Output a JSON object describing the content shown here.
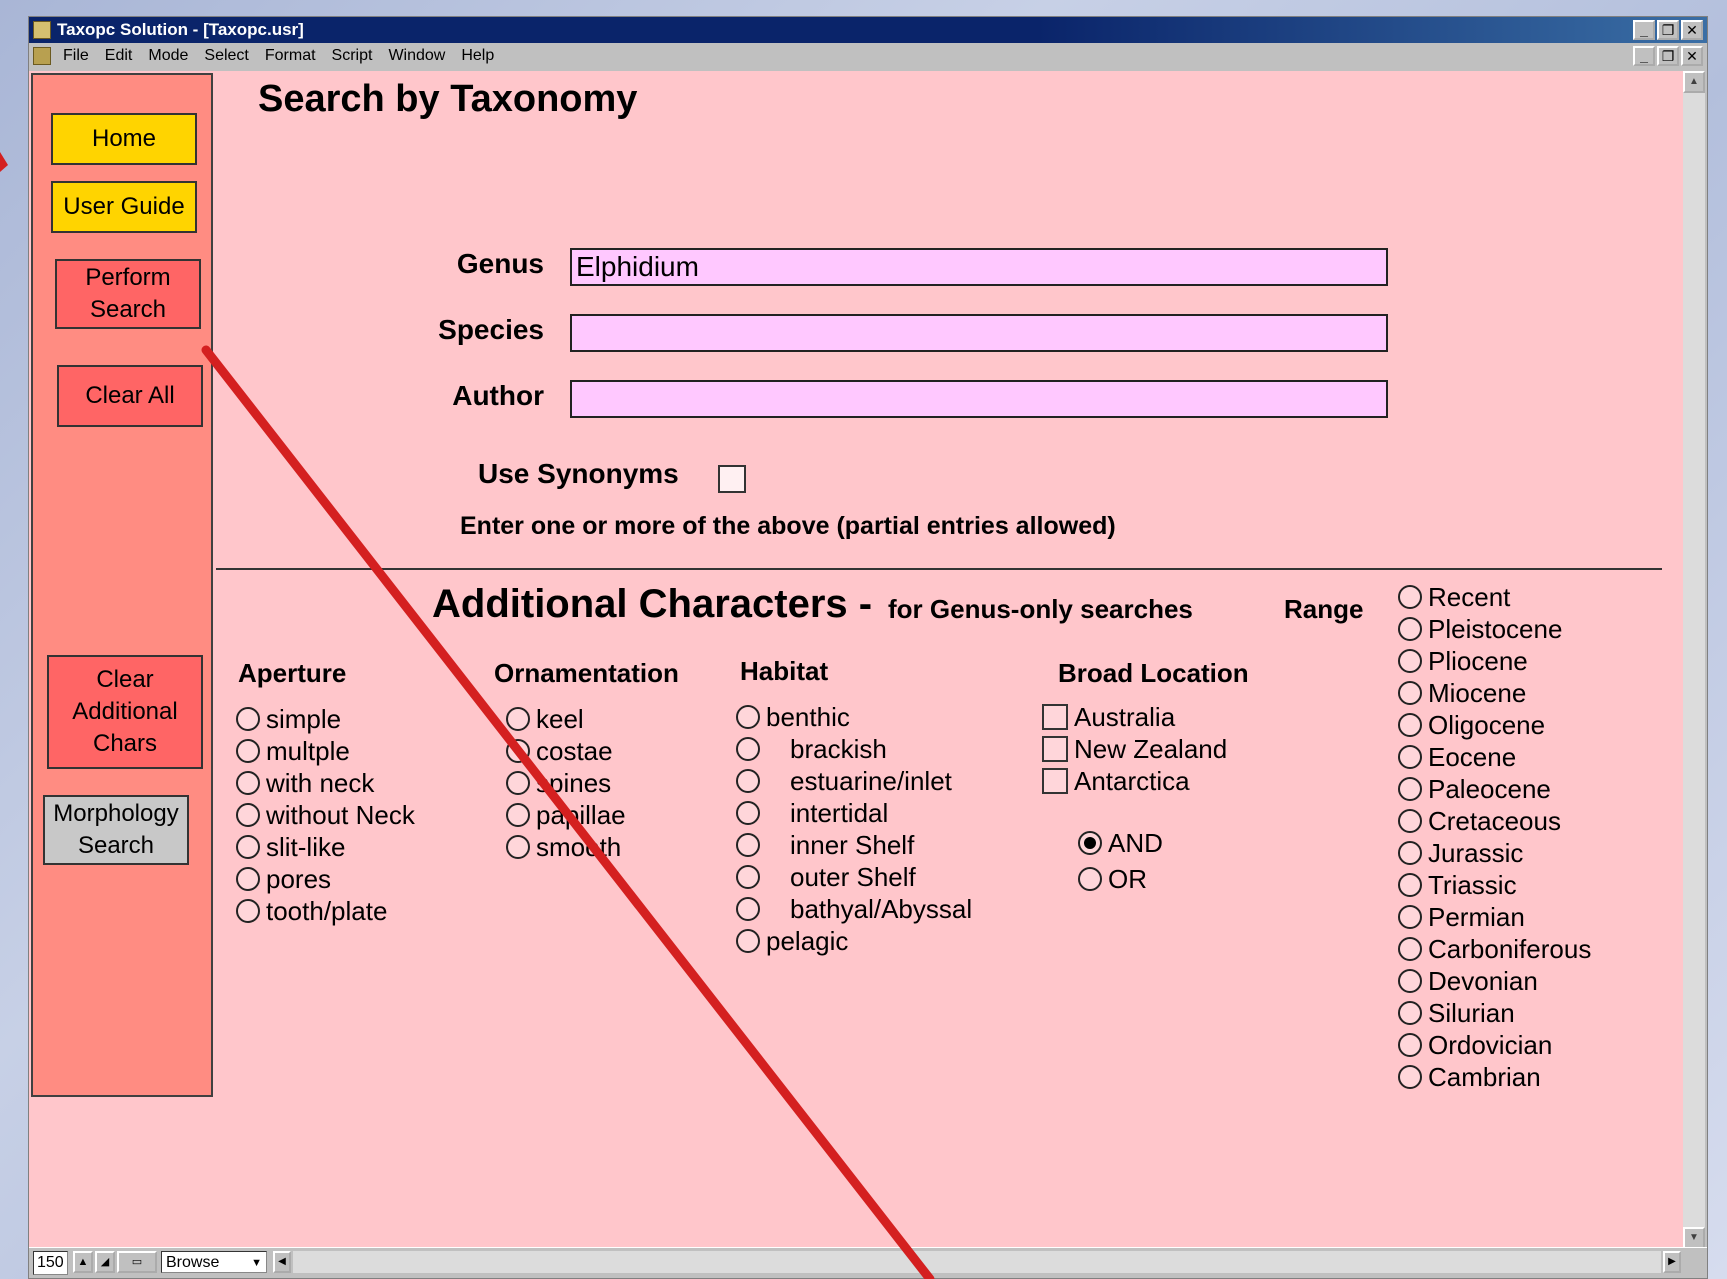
{
  "window": {
    "title": "Taxopc Solution - [Taxopc.usr]"
  },
  "menubar": {
    "items": [
      "File",
      "Edit",
      "Mode",
      "Select",
      "Format",
      "Script",
      "Window",
      "Help"
    ]
  },
  "sidebar": {
    "home": "Home",
    "user_guide": "User Guide",
    "perform_search_1": "Perform",
    "perform_search_2": "Search",
    "clear_all": "Clear All",
    "clear_add_1": "Clear",
    "clear_add_2": "Additional",
    "clear_add_3": "Chars",
    "morph_1": "Morphology",
    "morph_2": "Search"
  },
  "main": {
    "title": "Search by Taxonomy",
    "genus_label": "Genus",
    "genus_value": "Elphidium",
    "species_label": "Species",
    "species_value": "",
    "author_label": "Author",
    "author_value": "",
    "synonyms_label": "Use Synonyms",
    "hint": "Enter one or more of the above (partial entries allowed)"
  },
  "additional": {
    "title": "Additional Characters -",
    "subtitle": "for Genus-only searches",
    "aperture": {
      "label": "Aperture",
      "options": [
        "simple",
        "multple",
        "with neck",
        "without Neck",
        "slit-like",
        "pores",
        "tooth/plate"
      ]
    },
    "ornamentation": {
      "label": "Ornamentation",
      "options": [
        "keel",
        "costae",
        "spines",
        "papillae",
        "smooth"
      ]
    },
    "habitat": {
      "label": "Habitat",
      "options": [
        "benthic",
        "brackish",
        "estuarine/inlet",
        "intertidal",
        "inner Shelf",
        "outer Shelf",
        "bathyal/Abyssal",
        "pelagic"
      ]
    },
    "broad_location": {
      "label": "Broad Location",
      "options": [
        "Australia",
        "New Zealand",
        "Antarctica"
      ],
      "and": "AND",
      "or": "OR",
      "selected": "AND"
    },
    "range": {
      "label": "Range",
      "options": [
        "Recent",
        "Pleistocene",
        "Pliocene",
        "Miocene",
        "Oligocene",
        "Eocene",
        "Paleocene",
        "Cretaceous",
        "Jurassic",
        "Triassic",
        "Permian",
        "Carboniferous",
        "Devonian",
        "Silurian",
        "Ordovician",
        "Cambrian"
      ]
    }
  },
  "statusbar": {
    "zoom": "150",
    "mode": "Browse"
  },
  "colors": {
    "content_bg": "#ffc6cb",
    "sidebar_bg": "#ff8c82",
    "input_bg": "#ffc8ff",
    "annotation_arrow": "#d42020"
  }
}
